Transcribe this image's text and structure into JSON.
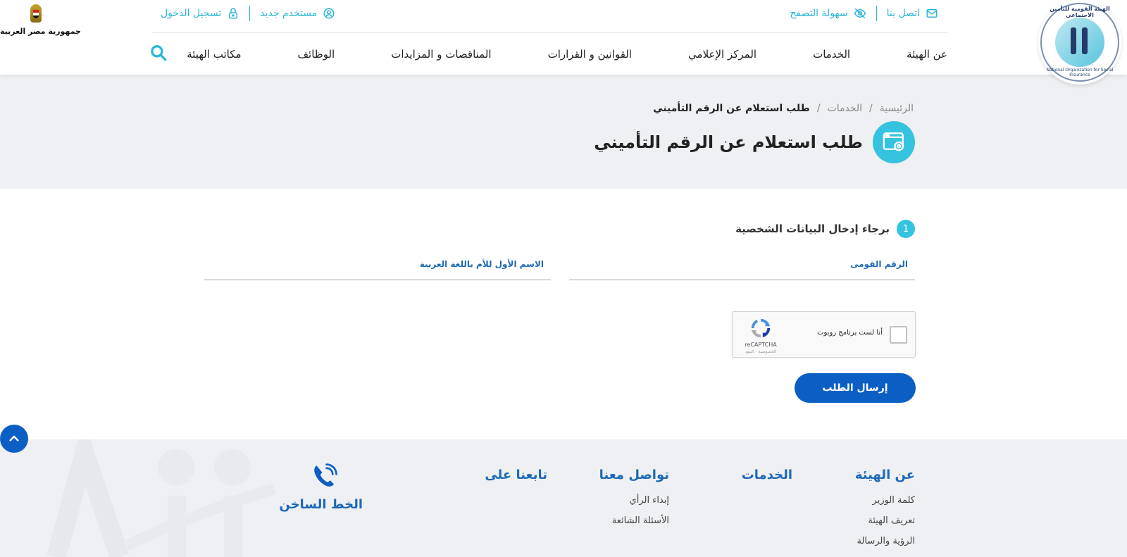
{
  "header": {
    "org_logo_text_ar": "الهيئة القومية للتأمين الاجتماعي",
    "org_logo_text_en": "National Organization for Social Insurance",
    "egypt_label": "جمهورية مصر العربية",
    "top_right_links": [
      {
        "label": "اتصل بنا",
        "icon": "mail-icon"
      },
      {
        "label": "سهولة التصفح",
        "icon": "eye-slash-icon"
      }
    ],
    "top_left_links": [
      {
        "label": "مستخدم جديد",
        "icon": "user-circle-icon"
      },
      {
        "label": "تسجيل الدخول",
        "icon": "lock-icon"
      }
    ],
    "nav": [
      "عن الهيئة",
      "الخدمات",
      "المركز الإعلامي",
      "القوانين و القرارات",
      "المناقصات و المزايدات",
      "الوظائف",
      "مكاتب الهيئة"
    ],
    "accent_color": "#27b6d8"
  },
  "banner": {
    "breadcrumb": [
      "الرئيسية",
      "الخدمات",
      "طلب استعلام عن الرقم التأميني"
    ],
    "breadcrumb_sep": "/",
    "title": "طلب استعلام عن الرقم التأميني"
  },
  "form": {
    "step_number": "1",
    "step_title": "برجاء إدخال البيانات الشخصية",
    "fields": {
      "national_id_label": "الرقم القومى",
      "national_id_value": "",
      "mother_name_label": "الاسم الأول للأم باللغة العربية",
      "mother_name_value": ""
    },
    "recaptcha": {
      "label": "أنا لست برنامج روبوت",
      "brand": "reCAPTCHA",
      "terms": "الخصوصية - البنود"
    },
    "submit_label": "إرسال الطلب",
    "primary_color": "#0b5fc4"
  },
  "footer": {
    "about": {
      "title": "عن الهيئة",
      "links": [
        "كلمة الوزير",
        "تعريف الهيئة",
        "الرؤية والرسالة"
      ]
    },
    "services": {
      "title": "الخدمات",
      "links": []
    },
    "contact": {
      "title": "تواصل معنا",
      "links": [
        "إبداء الرأي",
        "الأسئلة الشائعة"
      ]
    },
    "follow": {
      "title": "تابعنا على",
      "links": []
    },
    "hotline": {
      "label": "الخط الساخن",
      "icon": "phone-icon"
    }
  }
}
